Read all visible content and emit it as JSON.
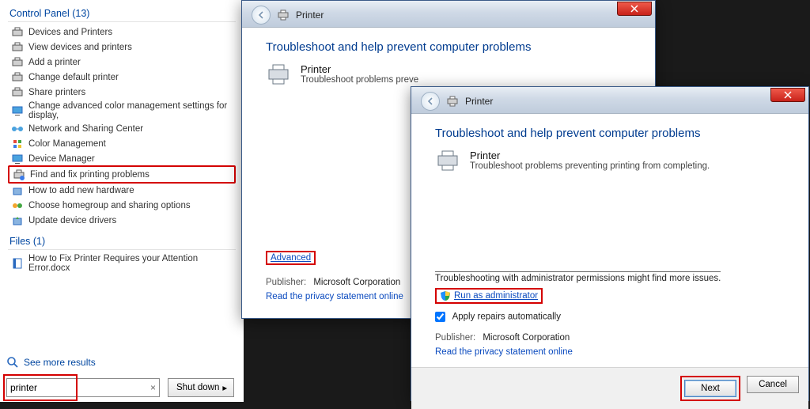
{
  "start_menu": {
    "cp_heading": "Control Panel (13)",
    "cp_items": [
      "Devices and Printers",
      "View devices and printers",
      "Add a printer",
      "Change default printer",
      "Share printers",
      "Change advanced color management settings for display,",
      "Network and Sharing Center",
      "Color Management",
      "Device Manager",
      "Find and fix printing problems",
      "How to add new hardware",
      "Choose homegroup and sharing options",
      "Update device drivers"
    ],
    "cp_highlight_index": 9,
    "files_heading": "Files (1)",
    "files_items": [
      "How to Fix Printer Requires your Attention Error.docx"
    ],
    "see_more": "See more results",
    "search_value": "printer",
    "shutdown_label": "Shut down"
  },
  "dialog1": {
    "breadcrumb": "Printer",
    "title": "Troubleshoot and help prevent computer problems",
    "item_name": "Printer",
    "item_desc": "Troubleshoot problems preve",
    "advanced": "Advanced",
    "publisher_label": "Publisher:",
    "publisher_value": "Microsoft Corporation",
    "privacy_link": "Read the privacy statement online"
  },
  "dialog2": {
    "breadcrumb": "Printer",
    "title": "Troubleshoot and help prevent computer problems",
    "item_name": "Printer",
    "item_desc": "Troubleshoot problems preventing printing from completing.",
    "admin_note": "Troubleshooting with administrator permissions might find more issues.",
    "run_as_admin": "Run as administrator",
    "apply_repairs": "Apply repairs automatically",
    "publisher_label": "Publisher:",
    "publisher_value": "Microsoft Corporation",
    "privacy_link": "Read the privacy statement online",
    "next": "Next",
    "cancel": "Cancel"
  }
}
